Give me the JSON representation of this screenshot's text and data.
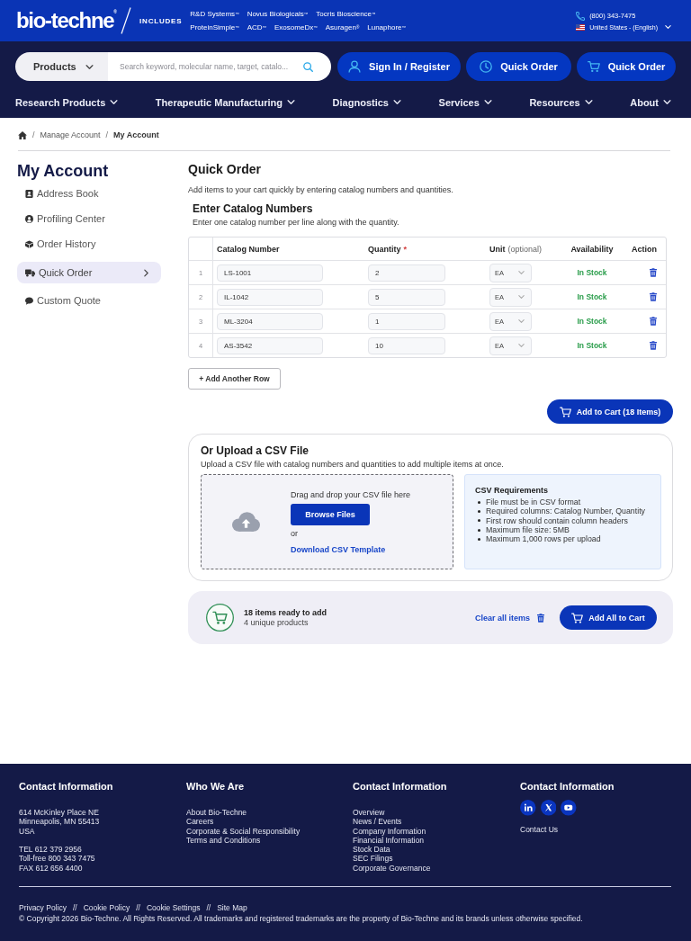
{
  "top_bar": {
    "logo": "bio-techne$^{®}$",
    "includes_label": "INCLUDES",
    "brand_rows": [
      [
        "R&D Systems$^{™}$",
        "Novus Biologicals$^{™}$",
        "Tocris Bioscience$^{™}$"
      ],
      [
        "ProteinSimple$^{™}$",
        "ACD$^{™}$",
        "ExosomeDx$^{™}$",
        "Asuragen$^{®}$",
        "Lunaphore$^{™}$"
      ]
    ],
    "phone": "(800) 343-7475",
    "locale": "United States - (English)"
  },
  "header": {
    "search": {
      "category": "Products",
      "placeholder": "Search keyword, molecular name, target, catalo..."
    },
    "buttons": [
      {
        "kind": "user",
        "label": "Sign In / Register"
      },
      {
        "kind": "clock",
        "label": "Quick Order"
      },
      {
        "kind": "cart",
        "label": "Quick Order"
      }
    ]
  },
  "nav_menu": [
    {
      "label": "Research Products"
    },
    {
      "label": "Therapeutic Manufacturing"
    },
    {
      "label": "Diagnostics"
    },
    {
      "label": "Services"
    },
    {
      "label": "Resources"
    },
    {
      "label": "About"
    }
  ],
  "breadcrumb": [
    {
      "kind": "home"
    },
    {
      "kind": "separator",
      "text": "/"
    },
    {
      "kind": "link",
      "text": "Manage Account"
    },
    {
      "kind": "separator",
      "text": "/"
    },
    {
      "kind": "current",
      "text": "My Account"
    }
  ],
  "sidebar": {
    "title": "My Account",
    "items": [
      {
        "kind": "address",
        "label": "Address Book",
        "selected": false
      },
      {
        "kind": "profile",
        "label": "Profiling Center",
        "selected": false
      },
      {
        "kind": "history",
        "label": "Order History",
        "selected": false
      },
      {
        "kind": "quick",
        "label": "Quick Order",
        "selected": true
      },
      {
        "kind": "quote",
        "label": "Custom Quote",
        "selected": false
      }
    ]
  },
  "quick_order": {
    "title": "Quick Order",
    "description": "Add items to your cart quickly by entering catalog numbers and quantities.",
    "section_title": "Enter Catalog Numbers",
    "section_hint": "Enter one catalog number per line along with the quantity.",
    "table": {
      "columns": [
        {
          "label": "Catalog Number"
        },
        {
          "label": "Quantity",
          "marker": "*"
        },
        {
          "label": "Unit",
          "note": "(optional)"
        },
        {
          "label": "Availability"
        },
        {
          "label": "Action"
        }
      ],
      "rows": [
        {
          "index": "1",
          "catalog_number": "LS-1001",
          "quantity": "2",
          "unit": "EA",
          "availability": "In Stock"
        },
        {
          "index": "2",
          "catalog_number": "IL-1042",
          "quantity": "5",
          "unit": "EA",
          "availability": "In Stock"
        },
        {
          "index": "3",
          "catalog_number": "ML-3204",
          "quantity": "1",
          "unit": "EA",
          "availability": "In Stock"
        },
        {
          "index": "4",
          "catalog_number": "AS-3542",
          "quantity": "10",
          "unit": "EA",
          "availability": "In Stock"
        }
      ]
    },
    "add_row_button": "+ Add Another Row",
    "add_to_cart_button": "Add to Cart (18 Items)"
  },
  "csv_upload": {
    "title": "Or Upload a CSV File",
    "description": "Upload a CSV file with catalog numbers and quantities to add multiple items at once.",
    "dropzone": {
      "prompt": "Drag and drop your CSV file here",
      "browse_button": "Browse Files",
      "or": "or",
      "template_link": "Download CSV Template"
    },
    "requirements": {
      "title": "CSV Requirements",
      "items": [
        "File must be in CSV format",
        "Required columns: Catalog Number, Quantity",
        "First row should contain column headers",
        "Maximum file size: 5MB",
        "Maximum 1,000 rows per upload"
      ]
    }
  },
  "summary": {
    "count": "18 items ready to add",
    "unique": "4 unique products",
    "clear_link": "Clear all items",
    "add_all_button": "Add All to Cart"
  },
  "footer": {
    "columns": [
      {
        "kind": "address",
        "title": "Contact Information",
        "groups": [
          [
            "614 McKinley Place NE",
            "Minneapolis, MN 55413",
            "USA"
          ],
          [
            "TEL 612 379 2956",
            "Toll-free 800 343 7475",
            "FAX 612 656 4400"
          ]
        ]
      },
      {
        "kind": "links",
        "title": "Who We Are",
        "groups": [
          [
            "About Bio-Techne",
            "Careers",
            "Corporate & Social Responsibility",
            "Terms and Conditions"
          ]
        ]
      },
      {
        "kind": "links",
        "title": "Contact Information",
        "groups": [
          [
            "Overview",
            "News / Events",
            "Company Information",
            "Financial Information",
            "Stock Data",
            "SEC Filings",
            "Corporate Governance"
          ]
        ]
      },
      {
        "kind": "social",
        "title": "Contact Information",
        "social": [
          {
            "kind": "linkedin"
          },
          {
            "kind": "x"
          },
          {
            "kind": "youtube"
          }
        ],
        "groups": [
          [
            "Contact Us"
          ]
        ]
      }
    ],
    "legal_links": [
      {
        "text": "Privacy Policy",
        "separator": "//"
      },
      {
        "text": "Cookie Policy",
        "separator": "//"
      },
      {
        "text": "Cookie Settings",
        "separator": "//"
      },
      {
        "text": "Site Map"
      }
    ],
    "copyright": "© Copyright 2026 Bio-Techne. All Rights Reserved. All trademarks and registered trademarks are the property of Bio-Techne and its brands unless otherwise specified."
  }
}
